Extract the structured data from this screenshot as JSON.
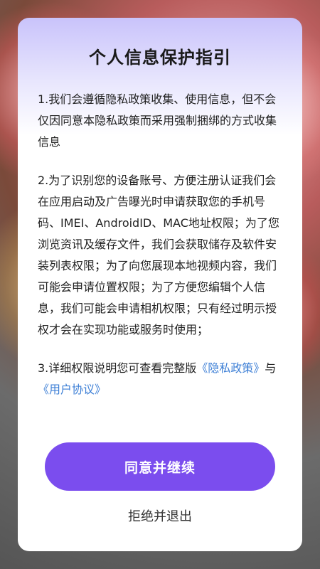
{
  "dialog": {
    "title": "个人信息保护指引",
    "paragraph1": "1.我们会遵循隐私政策收集、使用信息，但不会仅因同意本隐私政策而采用强制捆绑的方式收集信息",
    "paragraph2": "2.为了识别您的设备账号、方便注册认证我们会在应用启动及广告曝光时申请获取您的手机号码、IMEI、AndroidID、MAC地址权限；为了您浏览资讯及缓存文件，我们会获取储存及软件安装列表权限；为了向您展现本地视频内容，我们可能会申请位置权限；为了方便您编辑个人信息，我们可能会申请相机权限；只有经过明示授权才会在实现功能或服务时使用；",
    "paragraph3_prefix": "3.详细权限说明您可查看完整版",
    "privacy_policy_link": "《隐私政策》",
    "paragraph3_connector": "与",
    "user_agreement_link": "《用户协议》",
    "agree_button": "同意并继续",
    "reject_button": "拒绝并退出"
  },
  "colors": {
    "accent": "#7b4dee",
    "link": "#3d7fd6",
    "dialog_top_tint": "#c9c3fb"
  }
}
